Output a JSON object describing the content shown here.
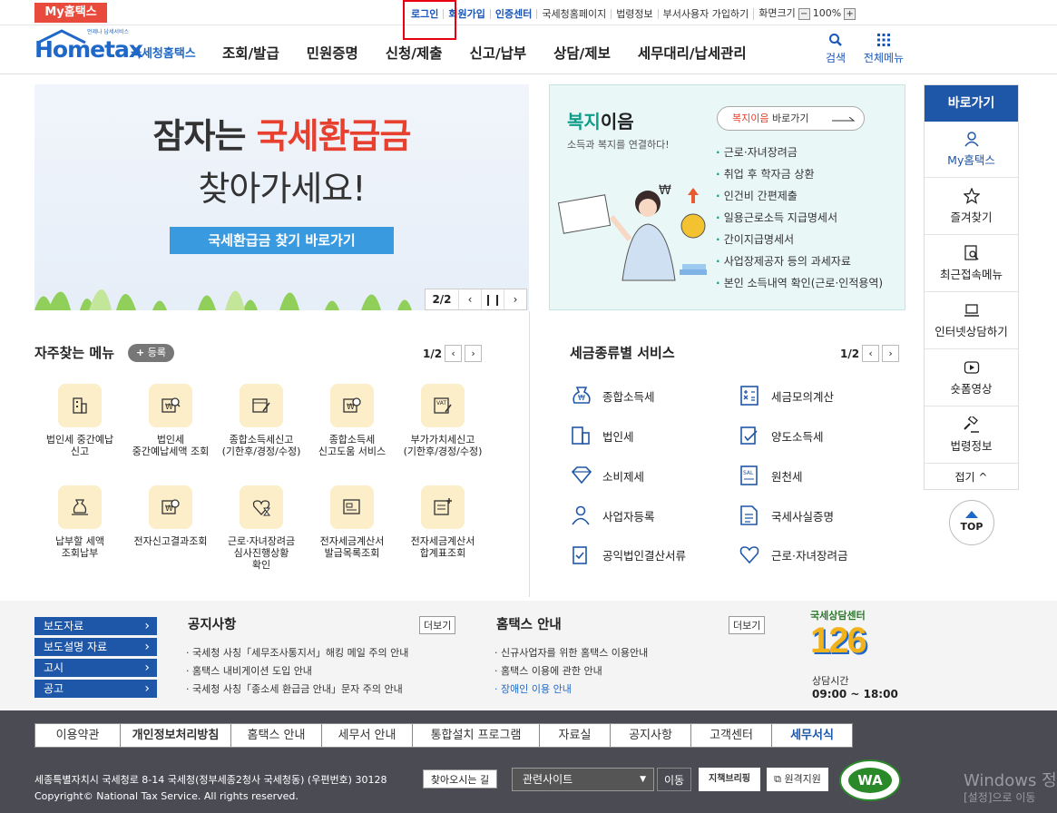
{
  "topbar": {
    "badge": "My홈택스",
    "links": [
      "로그인",
      "회원가입",
      "인증센터",
      "국세청홈페이지",
      "법령정보",
      "부서사용자 가입하기",
      "화면크기"
    ],
    "zoom": "100%"
  },
  "header": {
    "logo_text": "Hometax",
    "logo_sub": "국세청홈택스",
    "logo_small": "언제나 납세서비스",
    "nav": [
      "조회/발급",
      "민원증명",
      "신청/제출",
      "신고/납부",
      "상담/제보",
      "세무대리/납세관리"
    ],
    "search_label": "검색",
    "allmenu_label": "전체메뉴"
  },
  "banner1": {
    "line1_prefix": "잠자는 ",
    "line1_highlight": "국세환급금",
    "line2": "찾아가세요!",
    "button": "국세환급금 찾기 바로가기",
    "page": "2/2",
    "prev": "‹",
    "pause": "❙❙",
    "next": "›"
  },
  "banner2": {
    "title_a": "복지",
    "title_b": "이음",
    "subtitle": "소득과 복지를 연결하다!",
    "link_a": "복지이음",
    "link_b": " 바로가기",
    "items": [
      "근로·자녀장려금",
      "취업 후 학자금 상환",
      "인건비 간편제출",
      "일용근로소득 지급명세서",
      "간이지급명세서",
      "사업장제공자 등의 과세자료",
      "본인 소득내역 확인(근로·인적용역)"
    ]
  },
  "sidebar": {
    "title": "바로가기",
    "items": [
      "My홈택스",
      "즐겨찾기",
      "최근접속메뉴",
      "인터넷상담하기",
      "숏폼영상",
      "법령정보"
    ],
    "collapse": "접기 ^",
    "top": "TOP"
  },
  "favorites": {
    "title": "자주찾는 메뉴",
    "add": "등록",
    "page": "1/2",
    "items": [
      "법인세 중간예납\n신고",
      "법인세\n중간예납세액 조회",
      "종합소득세신고\n(기한후/경정/수정)",
      "종합소득세\n신고도움 서비스",
      "부가가치세신고\n(기한후/경정/수정)",
      "납부할 세액\n조회납부",
      "전자신고결과조회",
      "근로·자녀장려금\n심사진행상황\n확인",
      "전자세금계산서\n발급목록조회",
      "전자세금계산서\n합계표조회"
    ]
  },
  "taxservices": {
    "title": "세금종류별 서비스",
    "page": "1/2",
    "left": [
      "종합소득세",
      "법인세",
      "소비제세",
      "사업자등록",
      "공익법인결산서류"
    ],
    "right": [
      "세금모의계산",
      "양도소득세",
      "원천세",
      "국세사실증명",
      "근로·자녀장려금"
    ]
  },
  "notice": {
    "buttons": [
      "보도자료",
      "보도설명 자료",
      "고시",
      "공고"
    ],
    "notice_title": "공지사항",
    "more": "더보기",
    "notice_items": [
      "국세청 사칭「세무조사통지서」해킹 메일 주의 안내",
      "홈택스 내비게이션 도입 안내",
      "국세청 사칭「종소세 환급금 안내」문자 주의 안내"
    ],
    "guide_title": "홈택스 안내",
    "guide_items": [
      "신규사업자를 위한 홈택스 이용안내",
      "홈택스 이용에 관한 안내",
      "장애인 이용 안내"
    ],
    "call_title": "국세상담센터",
    "call_number": "126",
    "call_hours_label": "상담시간",
    "call_hours": "09:00 ~ 18:00"
  },
  "footer": {
    "menu": [
      "이용약관",
      "개인정보처리방침",
      "홈택스 안내",
      "세무서 안내",
      "통합설치 프로그램",
      "자료실",
      "공지사항",
      "고객센터",
      "세무서식"
    ],
    "address": "세종특별자치시 국세청로 8-14 국세청(정부세종2청사 국세청동) (우편번호) 30128",
    "find": "찾아오시는 길",
    "copyright": "Copyright© National Tax Service. All rights reserved.",
    "related": "관련사이트",
    "go": "이동",
    "policy": "지책브리핑",
    "remote": "원격지원",
    "wa": "WA",
    "windows": "Windows 정",
    "windows2": "[설정]으로 이동"
  },
  "colors": {
    "brand_blue": "#1f57a8",
    "accent_red": "#e84b3c",
    "teal": "#0f9d8a"
  }
}
